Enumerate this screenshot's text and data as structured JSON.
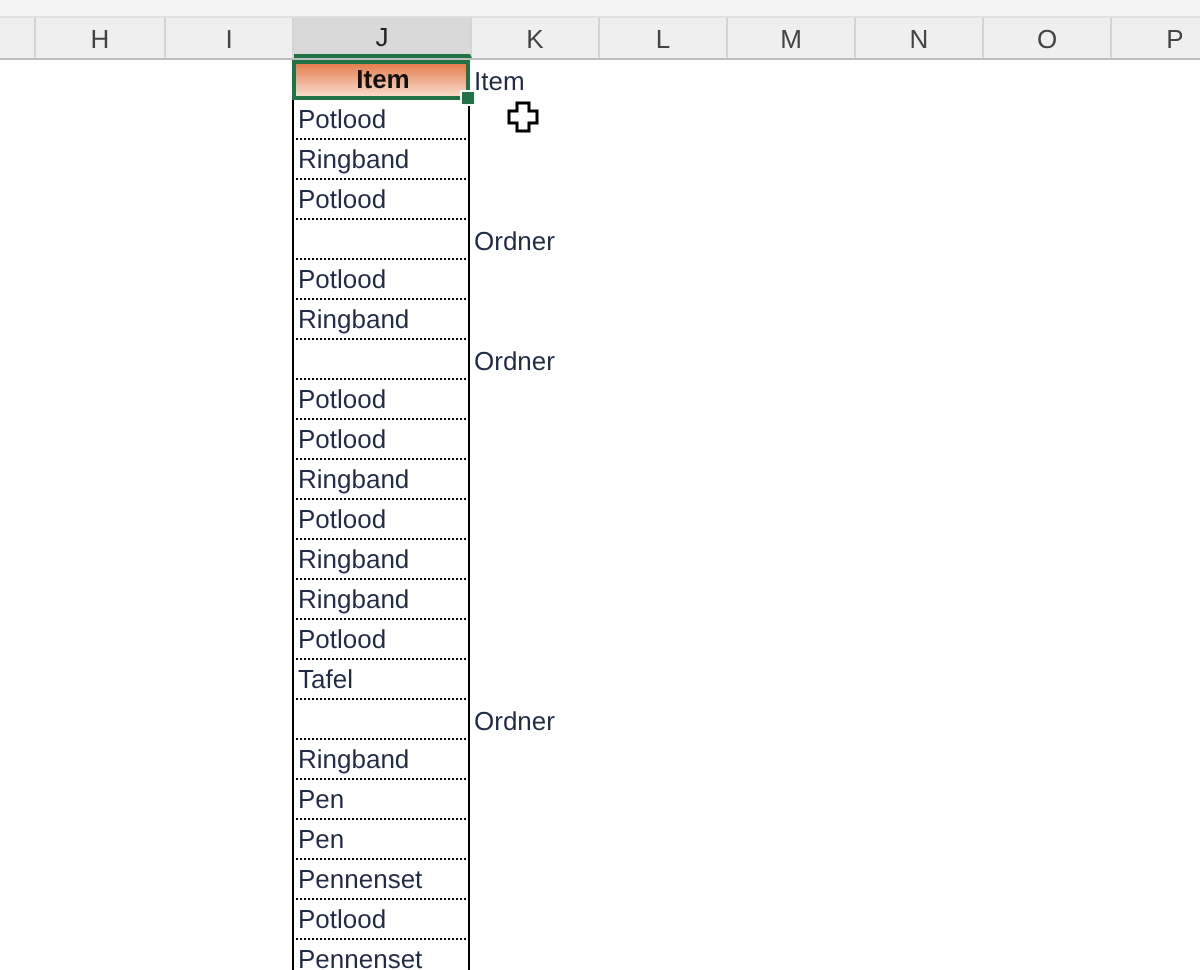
{
  "columns": [
    {
      "label": "H",
      "selected": false
    },
    {
      "label": "I",
      "selected": false
    },
    {
      "label": "J",
      "selected": true
    },
    {
      "label": "K",
      "selected": false
    },
    {
      "label": "L",
      "selected": false
    },
    {
      "label": "M",
      "selected": false
    },
    {
      "label": "N",
      "selected": false
    },
    {
      "label": "O",
      "selected": false
    },
    {
      "label": "P",
      "selected": false
    }
  ],
  "header_row": {
    "j": "Item",
    "k": "Item",
    "selected": true
  },
  "rows": [
    {
      "j": "Potlood"
    },
    {
      "j": "Ringband"
    },
    {
      "j": "Potlood"
    },
    {
      "k": "Ordner"
    },
    {
      "j": "Potlood"
    },
    {
      "j": "Ringband"
    },
    {
      "k": "Ordner"
    },
    {
      "j": "Potlood"
    },
    {
      "j": "Potlood"
    },
    {
      "j": "Ringband"
    },
    {
      "j": "Potlood"
    },
    {
      "j": "Ringband"
    },
    {
      "j": "Ringband"
    },
    {
      "j": "Potlood"
    },
    {
      "j": "Tafel"
    },
    {
      "k": "Ordner"
    },
    {
      "j": "Ringband"
    },
    {
      "j": "Pen"
    },
    {
      "j": "Pen"
    },
    {
      "j": "Pennenset"
    },
    {
      "j": "Potlood"
    },
    {
      "j": "Pennenset"
    }
  ]
}
